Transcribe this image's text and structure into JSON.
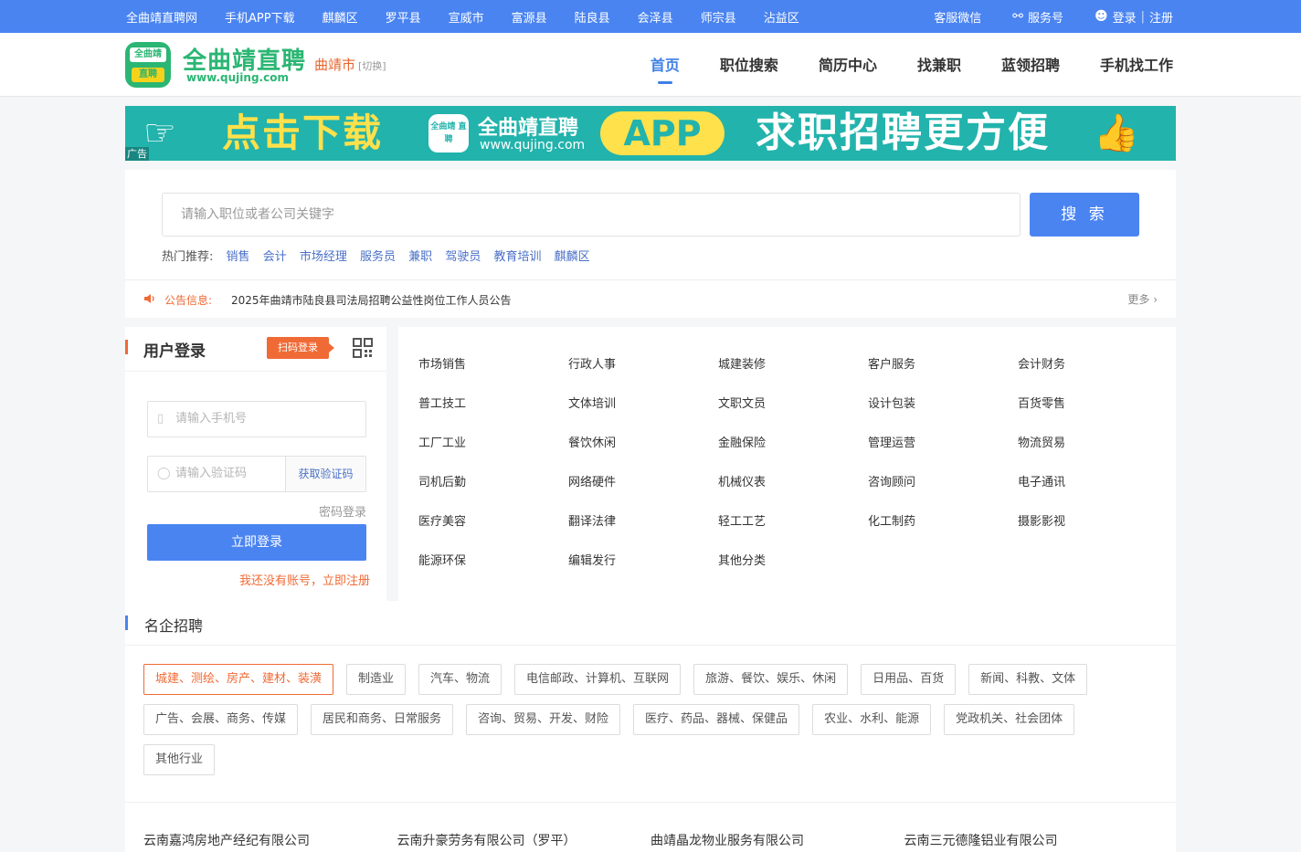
{
  "topbar": {
    "links": [
      "全曲靖直聘网",
      "手机APP下载",
      "麒麟区",
      "罗平县",
      "宣威市",
      "富源县",
      "陆良县",
      "会泽县",
      "师宗县",
      "沾益区"
    ],
    "wechat_service": "客服微信",
    "service_account": "服务号",
    "login": "登录",
    "register": "注册"
  },
  "header": {
    "logo_mark_top": "全曲靖",
    "logo_mark_bottom": "直聘",
    "logo_name": "全曲靖直聘",
    "logo_url": "www.qujing.com",
    "city": "曲靖市",
    "city_switch": "[切换]",
    "nav": [
      "首页",
      "职位搜索",
      "简历中心",
      "找兼职",
      "蓝领招聘",
      "手机找工作"
    ]
  },
  "banner": {
    "ad_tag": "广告",
    "headline": "点击下载",
    "brand_mark": "全曲靖 直聘",
    "brand_name": "全曲靖直聘",
    "brand_url": "www.qujing.com",
    "app": "APP",
    "slogan": "求职招聘更方便"
  },
  "search": {
    "placeholder": "请输入职位或者公司关键字",
    "button": "搜 索",
    "hot_label": "热门推荐:",
    "hot": [
      "销售",
      "会计",
      "市场经理",
      "服务员",
      "兼职",
      "驾驶员",
      "教育培训",
      "麒麟区"
    ]
  },
  "notice": {
    "label": "公告信息:",
    "text": "2025年曲靖市陆良县司法局招聘公益性岗位工作人员公告",
    "more": "更多 ›"
  },
  "login": {
    "title": "用户登录",
    "scan_tag": "扫码登录",
    "phone_placeholder": "请输入手机号",
    "code_placeholder": "请输入验证码",
    "get_code": "获取验证码",
    "password_login": "密码登录",
    "submit": "立即登录",
    "register_link": "我还没有账号，立即注册"
  },
  "categories": [
    "市场销售",
    "行政人事",
    "城建装修",
    "客户服务",
    "会计财务",
    "普工技工",
    "文体培训",
    "文职文员",
    "设计包装",
    "百货零售",
    "工厂工业",
    "餐饮休闲",
    "金融保险",
    "管理运营",
    "物流贸易",
    "司机后勤",
    "网络硬件",
    "机械仪表",
    "咨询顾问",
    "电子通讯",
    "医疗美容",
    "翻译法律",
    "轻工工艺",
    "化工制药",
    "摄影影视",
    "能源环保",
    "编辑发行",
    "其他分类"
  ],
  "famous": {
    "title": "名企招聘",
    "industries": [
      "城建、测绘、房产、建材、装潢",
      "制造业",
      "汽车、物流",
      "电信邮政、计算机、互联网",
      "旅游、餐饮、娱乐、休闲",
      "日用品、百货",
      "新闻、科教、文体",
      "广告、会展、商务、传媒",
      "居民和商务、日常服务",
      "咨询、贸易、开发、财险",
      "医疗、药品、器械、保健品",
      "农业、水利、能源",
      "党政机关、社会团体",
      "其他行业"
    ],
    "companies": [
      "云南嘉鸿房地产经纪有限公司",
      "云南升豪劳务有限公司（罗平）",
      "曲靖晶龙物业服务有限公司",
      "云南三元德隆铝业有限公司"
    ]
  },
  "colors": {
    "primary": "#4a84f1",
    "accent": "#f06a35",
    "brand_green": "#2bb673",
    "banner_bg": "#22b3ac"
  }
}
